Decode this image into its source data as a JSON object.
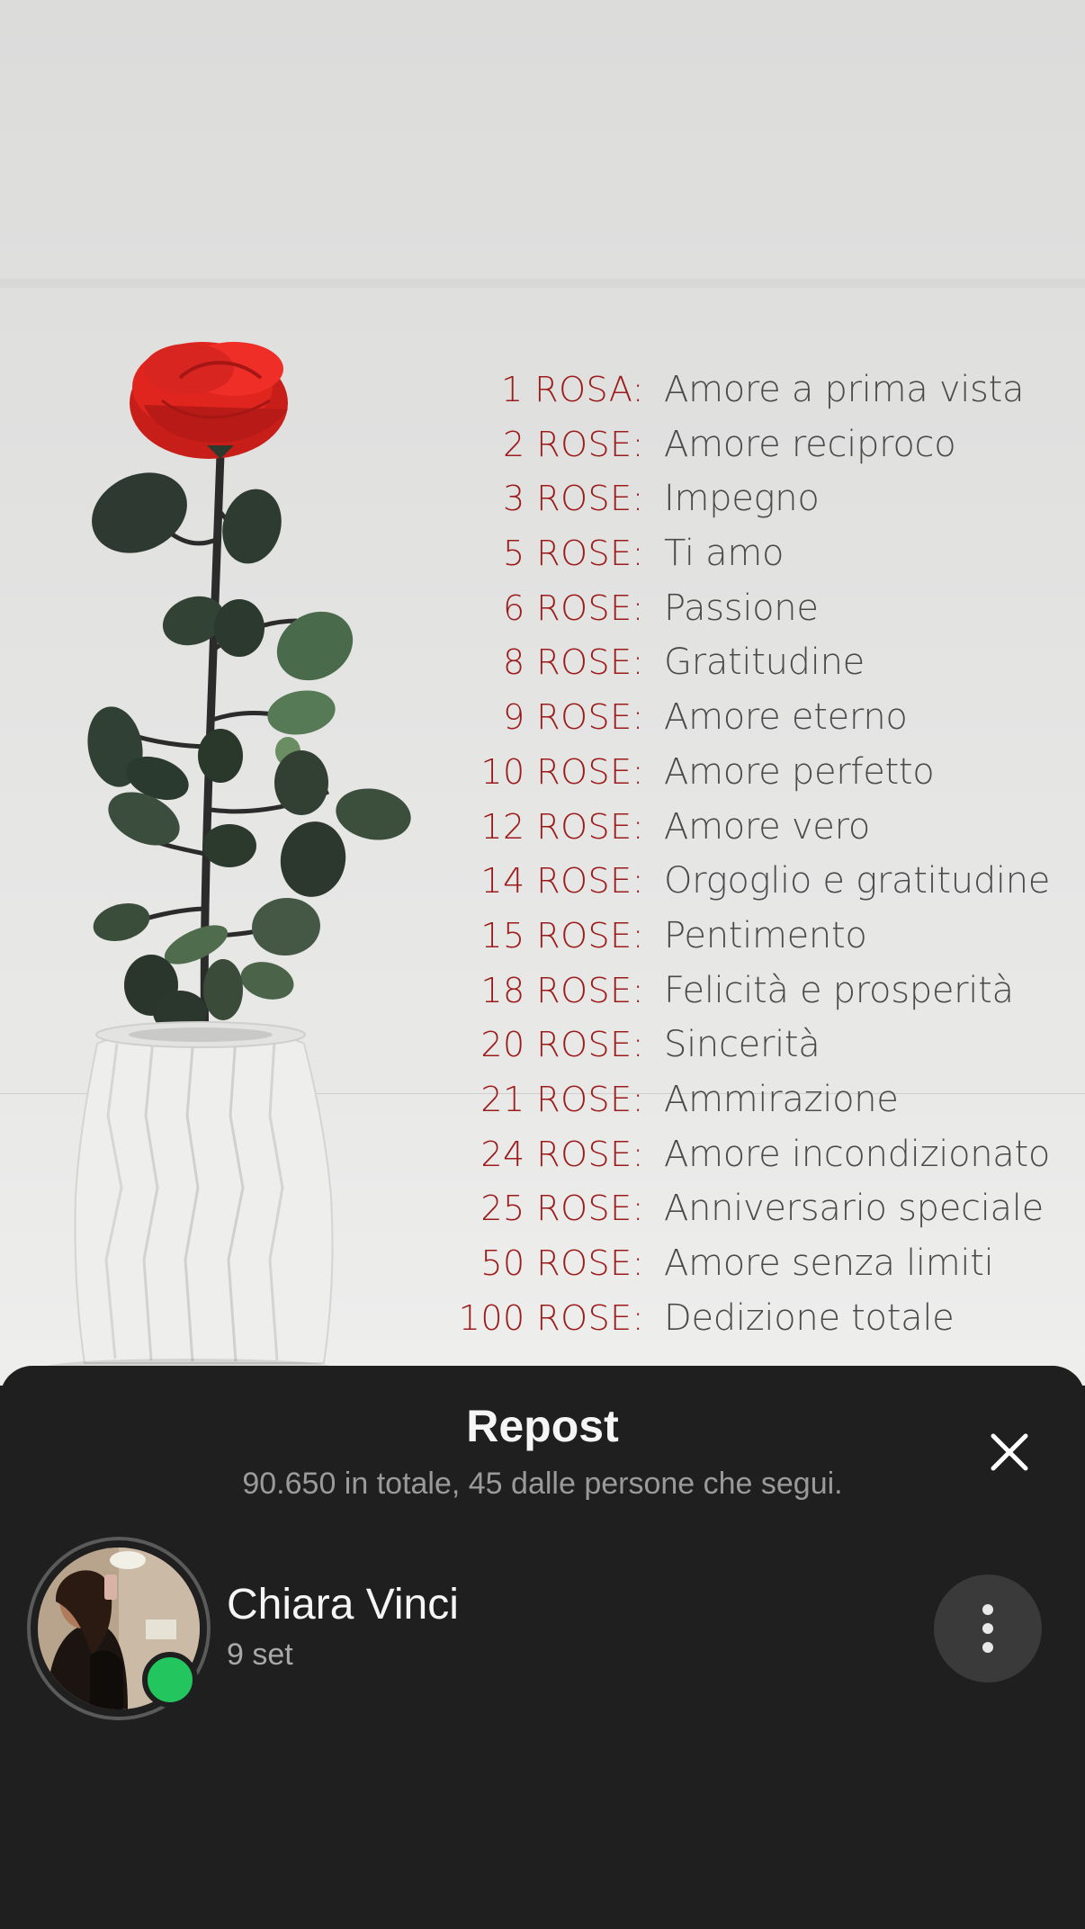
{
  "post": {
    "meanings": [
      {
        "count": "1 ROSA:",
        "text": "Amore a prima vista"
      },
      {
        "count": "2 ROSE:",
        "text": "Amore reciproco"
      },
      {
        "count": "3 ROSE:",
        "text": "Impegno"
      },
      {
        "count": "5 ROSE:",
        "text": "Ti amo"
      },
      {
        "count": "6 ROSE:",
        "text": "Passione"
      },
      {
        "count": "8 ROSE:",
        "text": "Gratitudine"
      },
      {
        "count": "9 ROSE:",
        "text": "Amore eterno"
      },
      {
        "count": "10 ROSE:",
        "text": "Amore perfetto"
      },
      {
        "count": "12 ROSE:",
        "text": "Amore vero"
      },
      {
        "count": "14 ROSE:",
        "text": "Orgoglio e gratitudine"
      },
      {
        "count": "15 ROSE:",
        "text": "Pentimento"
      },
      {
        "count": "18 ROSE:",
        "text": "Felicità e prosperità"
      },
      {
        "count": "20 ROSE:",
        "text": "Sincerità"
      },
      {
        "count": "21 ROSE:",
        "text": "Ammirazione"
      },
      {
        "count": "24 ROSE:",
        "text": "Amore incondizionato"
      },
      {
        "count": "25 ROSE:",
        "text": "Anniversario speciale"
      },
      {
        "count": "50 ROSE:",
        "text": "Amore senza limiti"
      },
      {
        "count": "100 ROSE:",
        "text": "Dedizione totale"
      }
    ],
    "colors": {
      "count_red": "#9c1b1b",
      "rose_red": "#e0251f",
      "leaf_green": "#2e3d30"
    }
  },
  "sheet": {
    "title": "Repost",
    "subtitle": "90.650 in totale, 45 dalle persone che segui.",
    "close_icon": "close-icon",
    "user": {
      "name": "Chiara Vinci",
      "date": "9 set",
      "status_color": "#22c55e"
    },
    "more_icon": "more-vertical-icon"
  }
}
